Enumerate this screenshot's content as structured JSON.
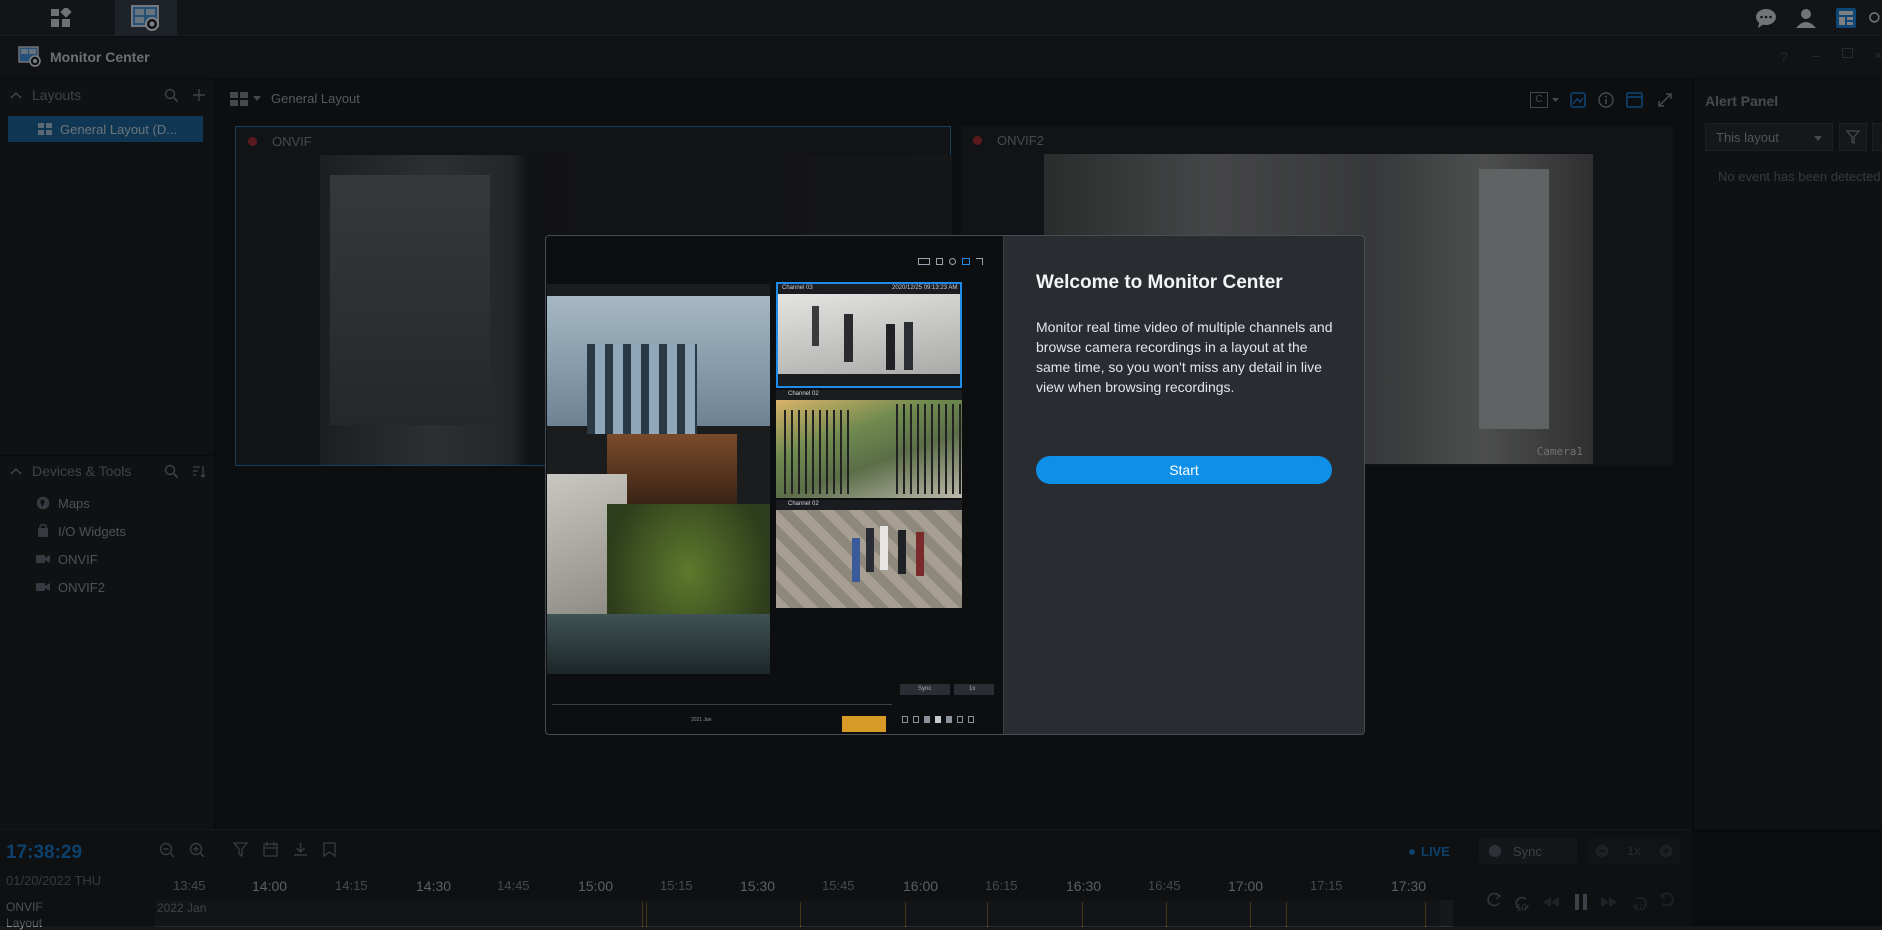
{
  "taskbar": {
    "apps": [
      "main-menu",
      "surveillance-app"
    ]
  },
  "window": {
    "title": "Monitor Center"
  },
  "sidebar": {
    "layouts_title": "Layouts",
    "layout_item": "General Layout (D...",
    "devices_title": "Devices & Tools",
    "devices": [
      {
        "label": "Maps",
        "icon": "map-icon"
      },
      {
        "label": "I/O Widgets",
        "icon": "io-widget-icon"
      },
      {
        "label": "ONVIF",
        "icon": "camera-icon"
      },
      {
        "label": "ONVIF2",
        "icon": "camera-icon"
      }
    ]
  },
  "toolbar": {
    "layout_name": "General Layout"
  },
  "cameras": [
    {
      "name": "ONVIF",
      "label": ""
    },
    {
      "name": "ONVIF2",
      "label": "Camera1"
    }
  ],
  "alert_panel": {
    "title": "Alert Panel",
    "filter_value": "This layout",
    "empty_text": "No event has been detected"
  },
  "welcome": {
    "title": "Welcome to Monitor Center",
    "body": "Monitor real time video of multiple channels and browse camera recordings in a layout at the same time, so you won't miss any detail in live view when browsing recordings.",
    "start_label": "Start",
    "preview": {
      "channel_top": "Channel 03",
      "timestamp": "2020/12/25 09:13:23 AM",
      "channel_mid": "Channel 02",
      "channel_bot": "Channel 02",
      "sync_label": "Sync",
      "speed_label": "1x",
      "timeline_label": "2021 Jan"
    }
  },
  "timeline": {
    "clock": "17:38:29",
    "date": "01/20/2022 THU",
    "live_label": "LIVE",
    "sync_label": "Sync",
    "speed_label": "1x",
    "ticks": [
      "13:45",
      "14:00",
      "14:15",
      "14:30",
      "14:45",
      "15:00",
      "15:15",
      "15:30",
      "15:45",
      "16:00",
      "16:15",
      "16:30",
      "16:45",
      "17:00",
      "17:15",
      "17:30"
    ],
    "row_labels": [
      "ONVIF",
      "Layout"
    ],
    "row_date": "2022 Jan",
    "skip_label_back": "10",
    "skip_label_fwd": "10"
  },
  "colors": {
    "accent": "#0a84e0",
    "start_button": "#0e8fe8",
    "selection": "#1e6fa8",
    "recording_dot": "#b8323a",
    "timeline_event": "#c98a1e"
  }
}
